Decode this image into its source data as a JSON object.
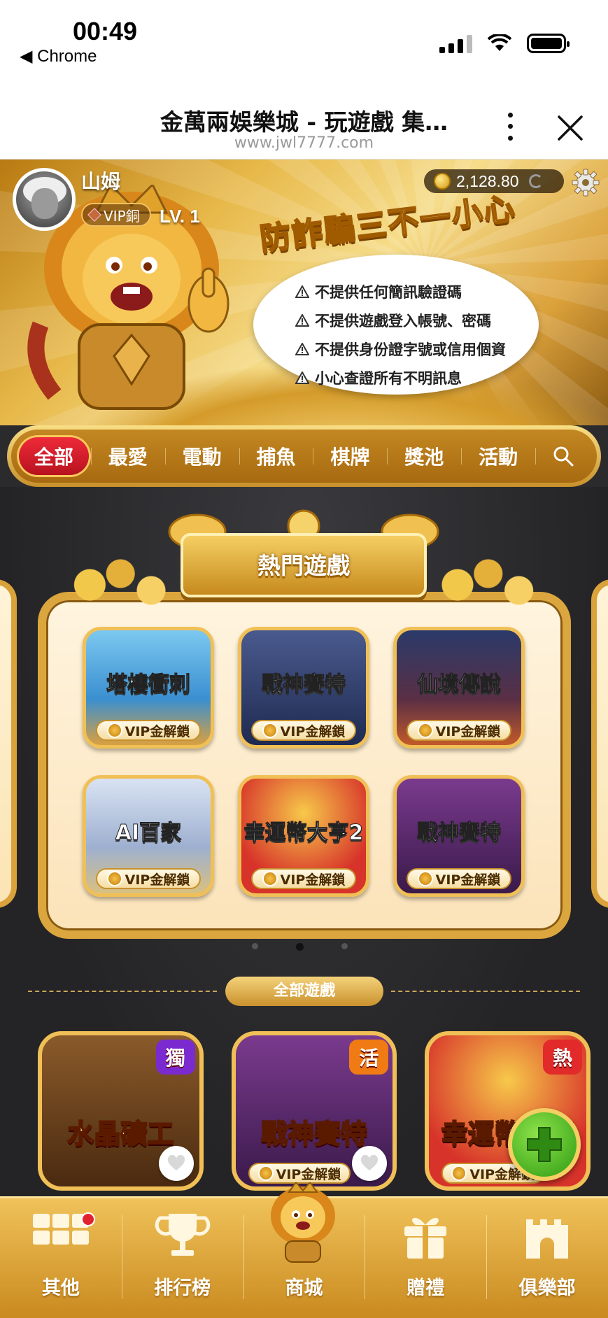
{
  "status": {
    "time": "00:49",
    "back_app": "Chrome"
  },
  "browser": {
    "title": "金萬兩娛樂城 - 玩遊戲 集…",
    "url": "www.jwl7777.com"
  },
  "profile": {
    "name": "山姆",
    "vip": "VIP銅",
    "level": "LV. 1",
    "balance": "2,128.80"
  },
  "banner": {
    "slogan": "防詐騙三不一小心",
    "tips": [
      "不提供任何簡訊驗證碼",
      "不提供遊戲登入帳號、密碼",
      "不提供身份證字號或信用個資",
      "小心查證所有不明訊息"
    ]
  },
  "tabs": [
    {
      "label": "全部",
      "active": true
    },
    {
      "label": "最愛"
    },
    {
      "label": "電動"
    },
    {
      "label": "捕魚"
    },
    {
      "label": "棋牌"
    },
    {
      "label": "獎池"
    },
    {
      "label": "活動"
    }
  ],
  "hot": {
    "title": "熱門遊戲",
    "games": [
      {
        "name": "塔樓衝刺",
        "lock": "VIP金解鎖",
        "bg": "#3aa6e8"
      },
      {
        "name": "戰神賽特",
        "lock": "VIP金解鎖",
        "bg": "#2b3a6e"
      },
      {
        "name": "仙境傳說",
        "lock": "VIP金解鎖",
        "bg": "#3b2f55"
      },
      {
        "name": "AI百家",
        "lock": "VIP金解鎖",
        "bg": "#b8c7e0"
      },
      {
        "name": "幸運幣大亨2",
        "lock": "VIP金解鎖",
        "bg": "#d7332a"
      },
      {
        "name": "戰神賽特",
        "lock": "VIP金解鎖",
        "bg": "#5b2a6e"
      }
    ]
  },
  "all_games": {
    "title": "全部遊戲",
    "games": [
      {
        "name": "水晶礦工",
        "tag": "獨",
        "tag_color": "#7b2ad0",
        "lock": "",
        "bg": "#6b3f1c"
      },
      {
        "name": "戰神賽特",
        "tag": "活",
        "tag_color": "#f07a14",
        "lock": "VIP金解鎖",
        "bg": "#5b2a6e"
      },
      {
        "name": "幸運幣大亨",
        "tag": "熱",
        "tag_color": "#e22a2a",
        "lock": "VIP金解鎖",
        "bg": "#d7332a"
      }
    ]
  },
  "nav": [
    {
      "label": "其他",
      "icon": "grid-icon"
    },
    {
      "label": "排行榜",
      "icon": "trophy-icon"
    },
    {
      "label": "商城",
      "icon": "lion-mascot-icon"
    },
    {
      "label": "贈禮",
      "icon": "gift-icon"
    },
    {
      "label": "俱樂部",
      "icon": "castle-icon"
    }
  ],
  "colors": {
    "accent": "#d9a23b",
    "active_tab": "#d81f2e",
    "fab": "#3cae1a"
  }
}
